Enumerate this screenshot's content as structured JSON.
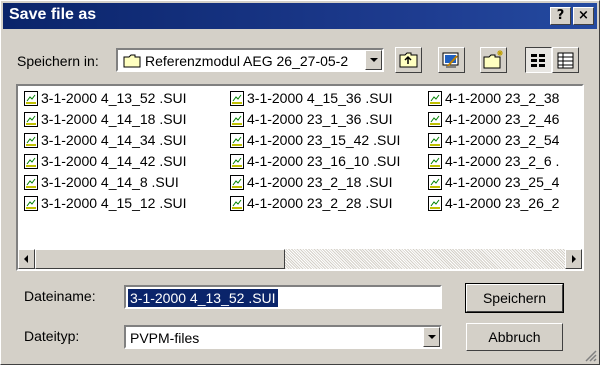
{
  "window": {
    "title": "Save file as",
    "help_label": "?",
    "close_label": "×"
  },
  "location": {
    "label": "Speichern in:",
    "label_accel": "i",
    "value": "Referenzmodul AEG 26_27-05-2"
  },
  "toolbar": {
    "icons": [
      "up-folder-icon",
      "desktop-icon",
      "new-folder-icon",
      "list-view-icon",
      "details-view-icon"
    ]
  },
  "files": [
    [
      "3-1-2000  4_13_52 .SUI",
      "3-1-2000  4_14_18 .SUI",
      "3-1-2000  4_14_34 .SUI",
      "3-1-2000  4_14_42 .SUI",
      "3-1-2000  4_14_8 .SUI",
      "3-1-2000  4_15_12 .SUI"
    ],
    [
      "3-1-2000  4_15_36 .SUI",
      "4-1-2000  23_1_36 .SUI",
      "4-1-2000  23_15_42 .SUI",
      "4-1-2000  23_16_10 .SUI",
      "4-1-2000  23_2_18 .SUI",
      "4-1-2000  23_2_28 .SUI"
    ],
    [
      "4-1-2000  23_2_38",
      "4-1-2000  23_2_46",
      "4-1-2000  23_2_54",
      "4-1-2000  23_2_6 .",
      "4-1-2000  23_25_4",
      "4-1-2000  23_26_2"
    ]
  ],
  "filename": {
    "label": "Dateiname:",
    "value": "3-1-2000  4_13_52 .SUI"
  },
  "filetype": {
    "label": "Dateityp:",
    "value": "PVPM-files"
  },
  "buttons": {
    "save": "Speichern",
    "cancel": "Abbruch"
  },
  "colors": {
    "title_bg": "#0a246a",
    "face": "#d4d0c8",
    "selection": "#0a246a"
  }
}
